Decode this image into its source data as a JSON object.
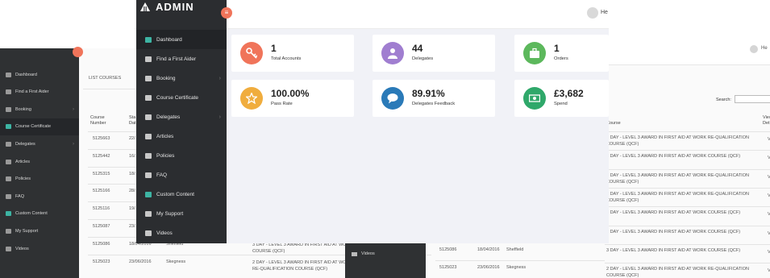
{
  "front": {
    "brand": "ADMIN",
    "user_name": "He",
    "sidebar": [
      {
        "label": "Dashboard",
        "icon": "dashboard-icon",
        "active": true
      },
      {
        "label": "Find a First Aider",
        "icon": "search-icon"
      },
      {
        "label": "Booking",
        "icon": "briefcase-icon",
        "chevron": true
      },
      {
        "label": "Course Certificate",
        "icon": "graduation-cap-icon"
      },
      {
        "label": "Delegates",
        "icon": "user-icon",
        "chevron": true
      },
      {
        "label": "Articles",
        "icon": "rss-icon"
      },
      {
        "label": "Policies",
        "icon": "megaphone-icon"
      },
      {
        "label": "FAQ",
        "icon": "question-icon"
      },
      {
        "label": "Custom Content",
        "icon": "image-icon",
        "green": true
      },
      {
        "label": "My Support",
        "icon": "tag-icon"
      },
      {
        "label": "Videos",
        "icon": "video-icon"
      }
    ],
    "cards": [
      {
        "value": "1",
        "label": "Total Accounts",
        "color": "#f0745a",
        "icon": "key-icon"
      },
      {
        "value": "44",
        "label": "Delegates",
        "color": "#a07ed0",
        "icon": "user-icon"
      },
      {
        "value": "1",
        "label": "Orders",
        "color": "#5cb85c",
        "icon": "briefcase-icon"
      },
      {
        "value": "100.00%",
        "label": "Pass Rate",
        "color": "#f0ad3e",
        "icon": "star-icon"
      },
      {
        "value": "89.91%",
        "label": "Delegates Feedback",
        "color": "#2a7ab8",
        "icon": "comment-icon"
      },
      {
        "value": "£3,682",
        "label": "Spend",
        "color": "#2fa86a",
        "icon": "money-icon"
      }
    ]
  },
  "back_left": {
    "sidebar": [
      {
        "label": "Dashboard"
      },
      {
        "label": "Find a First Aider"
      },
      {
        "label": "Booking",
        "chevron": true
      },
      {
        "label": "Course Certificate",
        "active": true
      },
      {
        "label": "Delegates",
        "chevron": true
      },
      {
        "label": "Articles"
      },
      {
        "label": "Policies"
      },
      {
        "label": "FAQ"
      },
      {
        "label": "Custom Content",
        "green": true
      },
      {
        "label": "My Support"
      },
      {
        "label": "Videos"
      }
    ],
    "panel_title": "LIST COURSES",
    "col_course_number": "Course Number",
    "col_start": "Sta Dat",
    "rows": [
      {
        "number": "5125663",
        "date": "22/"
      },
      {
        "number": "5125442",
        "date": "16/"
      },
      {
        "number": "5125315",
        "date": "18/"
      },
      {
        "number": "5125166",
        "date": "28/"
      },
      {
        "number": "5125116",
        "date": "19/"
      },
      {
        "number": "5125087",
        "date": "23/"
      },
      {
        "number": "5125086",
        "date": "18/04/2016",
        "venue": "Sheffield",
        "course": "3 DAY - LEVEL 3 AWARD IN FIRST AID AT WORK COURSE (QCF)"
      },
      {
        "number": "5125023",
        "date": "23/06/2016",
        "venue": "Skegness",
        "course": "2 DAY - LEVEL 3 AWARD IN FIRST AID AT WORK RE-QUALIFICATION COURSE (QCF)"
      }
    ]
  },
  "back_right": {
    "user_name": "He",
    "search_label": "Search:",
    "col_course": "Course",
    "col_view": "View Det",
    "rows": [
      {
        "course": "2 DAY - LEVEL 3 AWARD IN FIRST AID AT WORK RE-QUALIFICATION COURSE (QCF)",
        "view": "V"
      },
      {
        "course": "3 DAY - LEVEL 3 AWARD IN FIRST AID AT WORK COURSE (QCF)",
        "view": "V"
      },
      {
        "course": "2 DAY - LEVEL 3 AWARD IN FIRST AID AT WORK RE-QUALIFICATION COURSE (QCF)",
        "view": "V"
      },
      {
        "course": "2 DAY - LEVEL 3 AWARD IN FIRST AID AT WORK RE-QUALIFICATION COURSE (QCF)",
        "view": "V"
      },
      {
        "course": "3 DAY - LEVEL 3 AWARD IN FIRST AID AT WORK COURSE (QCF)",
        "view": "V"
      },
      {
        "course": "3 DAY - LEVEL 3 AWARD IN FIRST AID AT WORK COURSE (QCF)",
        "view": "V"
      },
      {
        "course": "3 DAY - LEVEL 3 AWARD IN FIRST AID AT WORK COURSE (QCF)",
        "view": "V"
      },
      {
        "course": "2 DAY - LEVEL 3 AWARD IN FIRST AID AT WORK RE-QUALIFICATION COURSE (QCF)",
        "view": "V"
      }
    ]
  },
  "bottom_center": {
    "sidebar_item": "Videos",
    "rows": [
      {
        "number": "5125086",
        "date": "18/04/2016",
        "venue": "Sheffield"
      },
      {
        "number": "5125023",
        "date": "23/06/2016",
        "venue": "Skegness"
      }
    ]
  }
}
